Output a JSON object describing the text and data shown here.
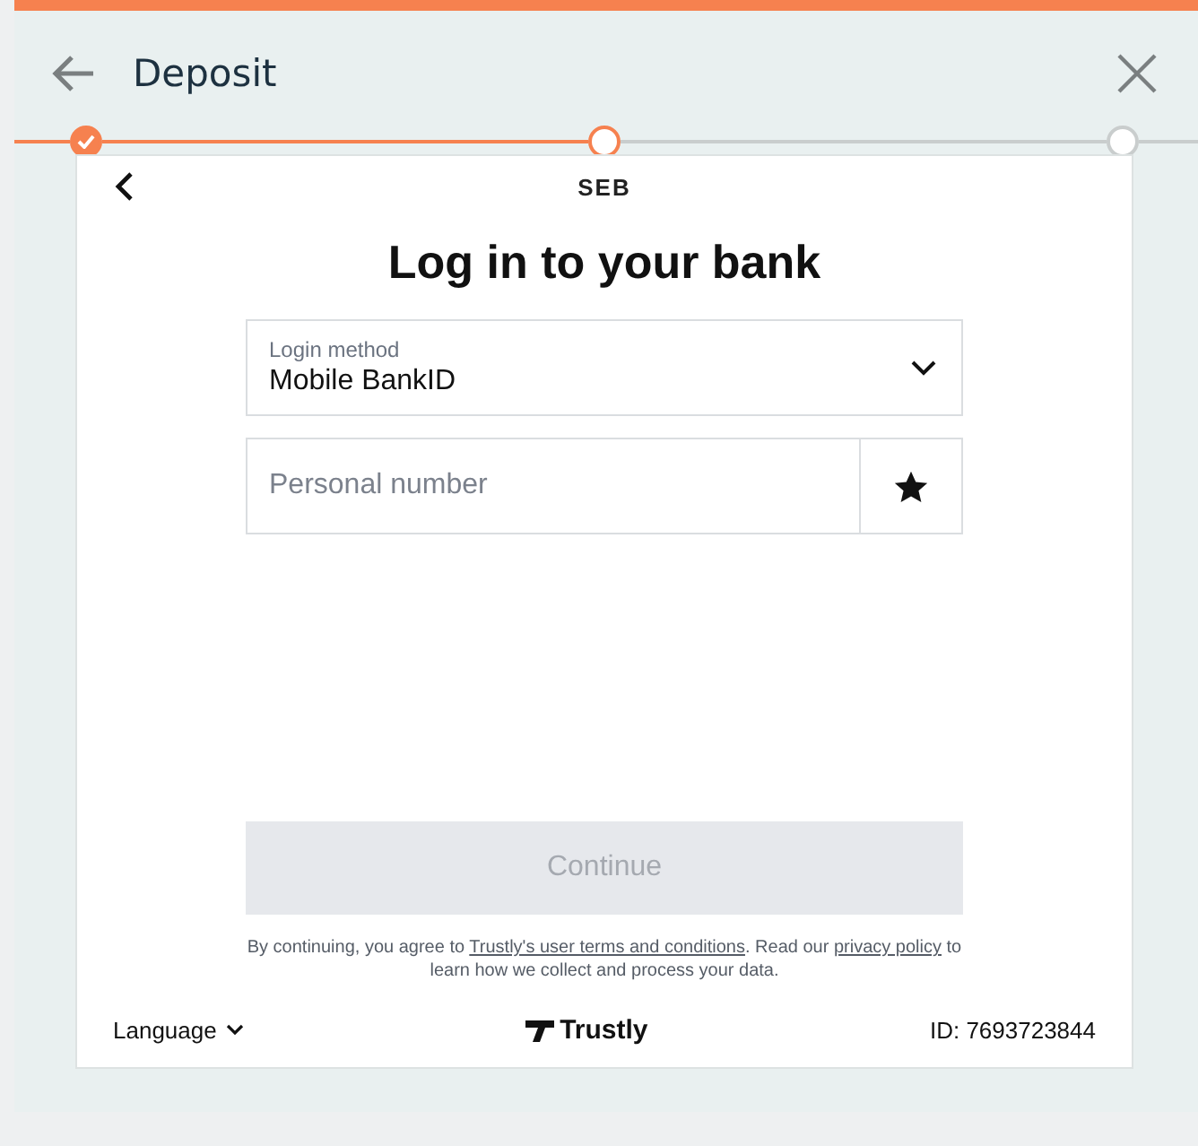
{
  "header": {
    "title": "Deposit"
  },
  "steps": [
    {
      "completed": true,
      "current": false
    },
    {
      "completed": false,
      "current": true
    },
    {
      "completed": false,
      "current": false
    }
  ],
  "bank": {
    "logo": "SEB",
    "heading": "Log in to your bank"
  },
  "login_method": {
    "label": "Login method",
    "value": "Mobile BankID"
  },
  "personal_number": {
    "placeholder": "Personal number"
  },
  "continue_button": {
    "label": "Continue",
    "disabled": true
  },
  "legal": [
    {
      "kind": "text",
      "text": "By continuing, you agree to "
    },
    {
      "kind": "link",
      "text": "Trustly's user terms and conditions"
    },
    {
      "kind": "text",
      "text": ". Read our "
    },
    {
      "kind": "link",
      "text": "privacy policy"
    },
    {
      "kind": "text",
      "text": " to learn how we collect and process your data."
    }
  ],
  "footer": {
    "language": "Language",
    "brand": "Trustly",
    "id": "ID: 7693723844"
  }
}
